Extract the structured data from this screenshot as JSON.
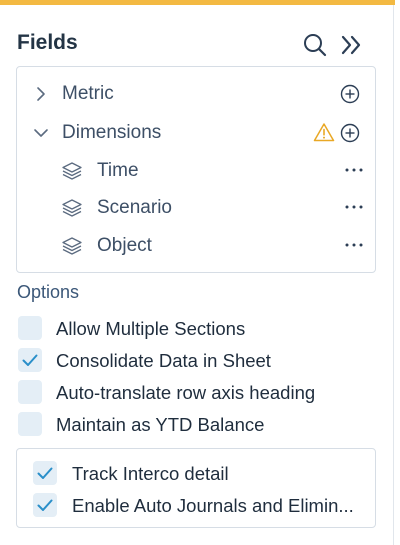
{
  "header": {
    "title": "Fields"
  },
  "fields": {
    "items": [
      {
        "label": "Metric"
      },
      {
        "label": "Dimensions"
      },
      {
        "label": "Time"
      },
      {
        "label": "Scenario"
      },
      {
        "label": "Object"
      }
    ]
  },
  "options": {
    "title": "Options",
    "items": [
      {
        "label": "Allow Multiple Sections",
        "checked": false
      },
      {
        "label": "Consolidate Data in Sheet",
        "checked": true
      },
      {
        "label": "Auto-translate row axis heading",
        "checked": false
      },
      {
        "label": "Maintain as YTD Balance",
        "checked": false
      }
    ],
    "sub_items": [
      {
        "label": "Track Interco detail",
        "checked": true
      },
      {
        "label": "Enable Auto Journals and Elimin...",
        "checked": true
      }
    ]
  },
  "colors": {
    "accent": "#f3b942",
    "checkbox_bg": "#e4eef6",
    "check": "#2a8fc9",
    "warning": "#e9a825"
  }
}
